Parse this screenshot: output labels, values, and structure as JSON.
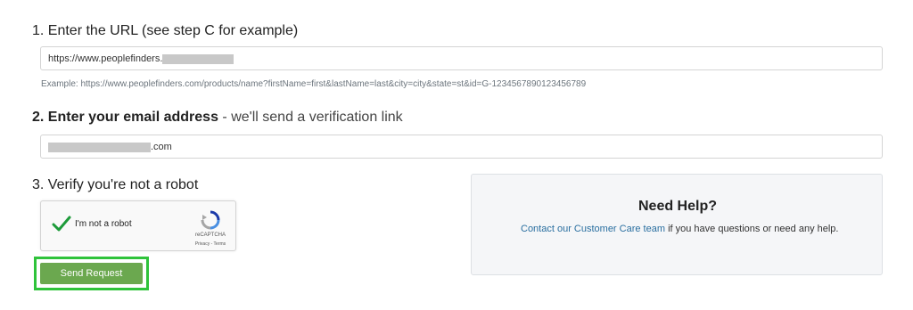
{
  "step1": {
    "heading": "1. Enter the URL (see step C for example)",
    "url_value": "https://www.peoplefinders.",
    "example": "Example: https://www.peoplefinders.com/products/name?firstName=first&lastName=last&city=city&state=st&id=G-1234567890123456789"
  },
  "step2": {
    "heading_bold": "2. Enter your email address",
    "heading_rest": " - we'll send a verification link",
    "email_suffix": ".com"
  },
  "step3": {
    "heading": "3. Verify you're not a robot",
    "captcha_label": "I'm not a robot",
    "captcha_brand": "reCAPTCHA",
    "captcha_links": "Privacy - Terms",
    "send_label": "Send Request"
  },
  "help": {
    "title": "Need Help?",
    "link_text": "Contact our Customer Care team",
    "rest_text": " if you have questions or need any help."
  },
  "colors": {
    "accent_green": "#2fc33b",
    "button_green": "#6ba84f",
    "link_blue": "#2a6fa0"
  }
}
